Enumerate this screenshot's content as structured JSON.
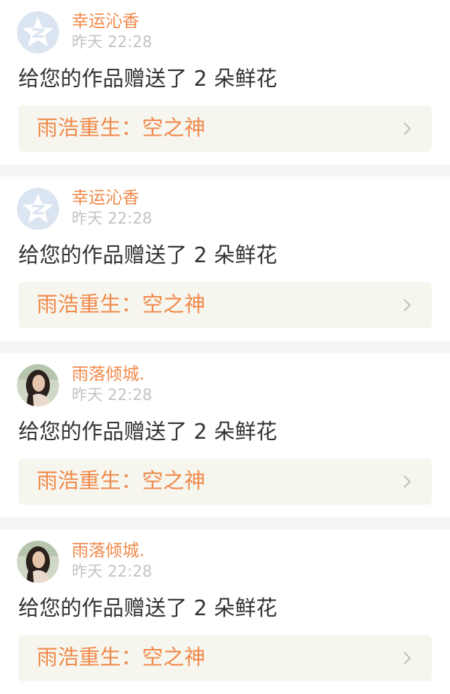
{
  "colors": {
    "accent": "#f08a4b",
    "time": "#c4c4c4",
    "message": "#333333",
    "link_bg": "#f6f6ef",
    "page_bg": "#f4f4f4"
  },
  "notifications": [
    {
      "avatar_icon": "qzone-star-icon",
      "username": "幸运沁香",
      "time": "昨天 22:28",
      "message": "给您的作品赠送了 2 朵鲜花",
      "work_title": "雨浩重生：空之神"
    },
    {
      "avatar_icon": "qzone-star-icon",
      "username": "幸运沁香",
      "time": "昨天 22:28",
      "message": "给您的作品赠送了 2 朵鲜花",
      "work_title": "雨浩重生：空之神"
    },
    {
      "avatar_icon": "profile-photo",
      "username": "雨落倾城.",
      "time": "昨天 22:28",
      "message": "给您的作品赠送了 2 朵鲜花",
      "work_title": "雨浩重生：空之神"
    },
    {
      "avatar_icon": "profile-photo",
      "username": "雨落倾城.",
      "time": "昨天 22:28",
      "message": "给您的作品赠送了 2 朵鲜花",
      "work_title": "雨浩重生：空之神"
    }
  ]
}
